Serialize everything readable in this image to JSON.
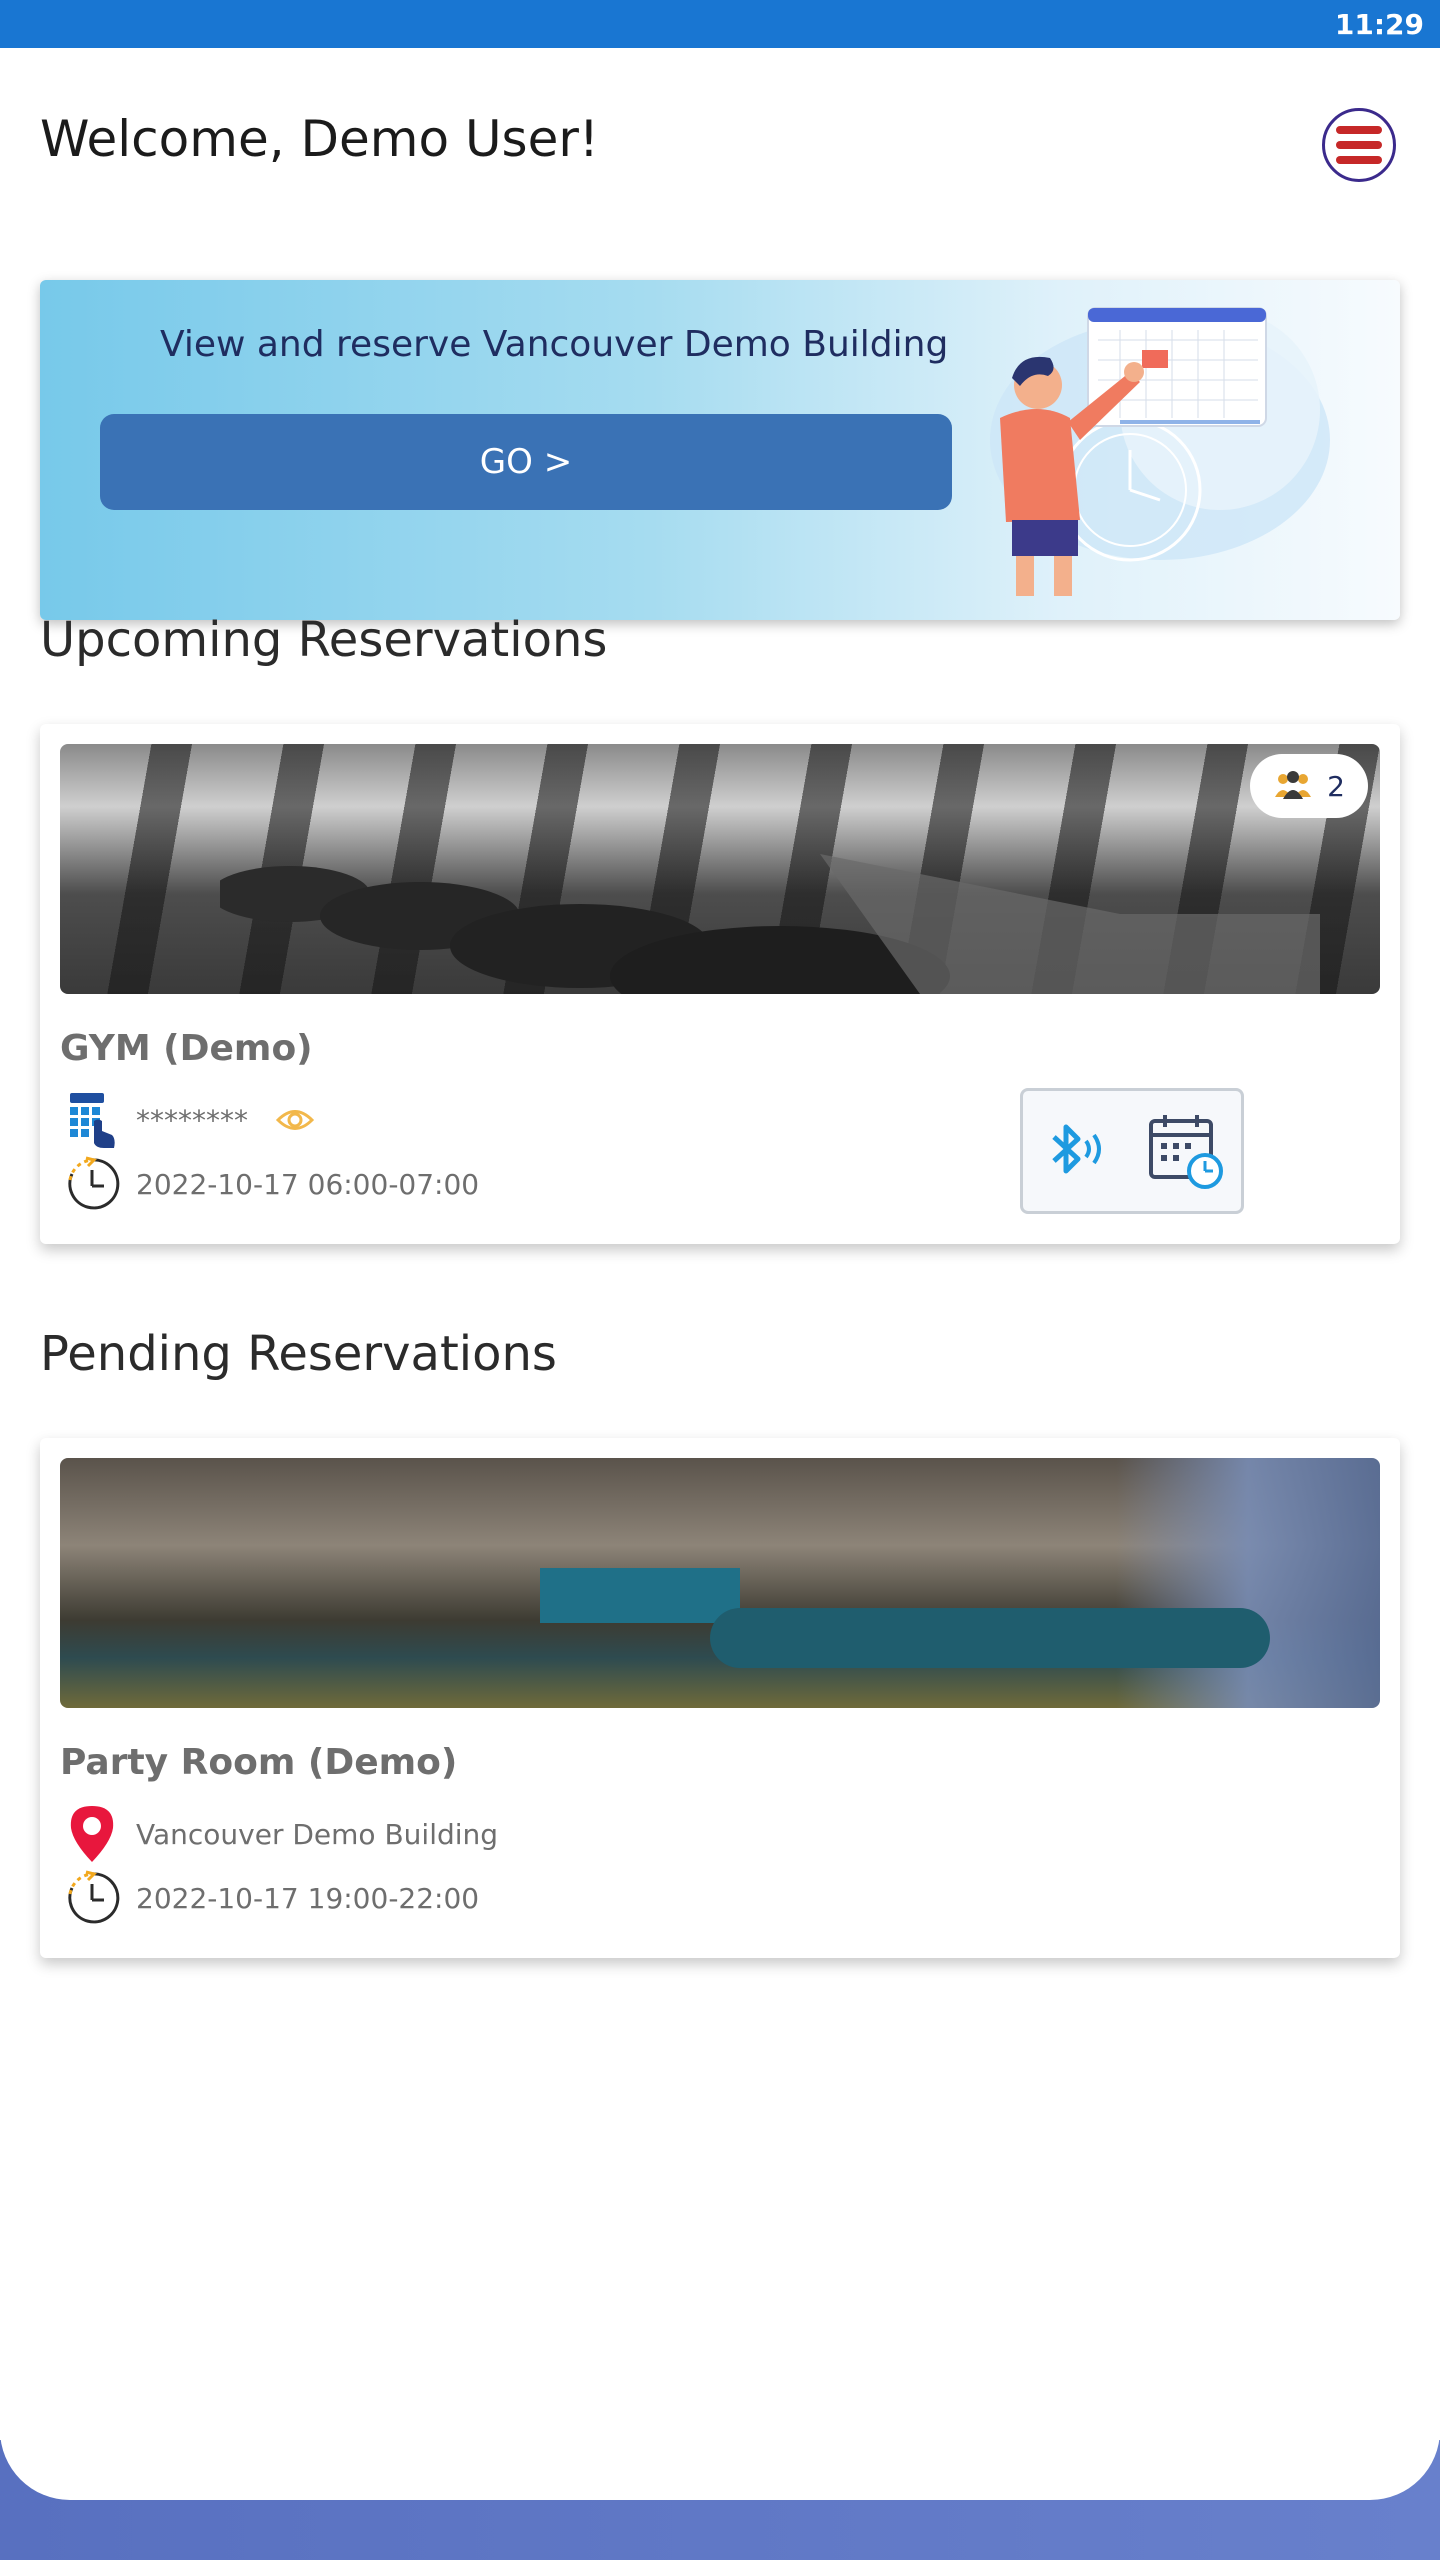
{
  "status_bar": {
    "time": "11:29"
  },
  "header": {
    "welcome": "Welcome, Demo User!",
    "menu_icon": "hamburger-menu-icon"
  },
  "banner": {
    "title": "View and reserve Vancouver Demo Building",
    "go_label": "GO >"
  },
  "upcoming": {
    "section_title": "Upcoming Reservations",
    "card": {
      "name": "GYM (Demo)",
      "participant_count": "2",
      "code": "********",
      "time": "2022-10-17 06:00-07:00"
    }
  },
  "pending": {
    "section_title": "Pending Reservations",
    "card": {
      "name": "Party Room (Demo)",
      "location": "Vancouver Demo Building",
      "time": "2022-10-17 19:00-22:00"
    }
  },
  "colors": {
    "status_bar": "#1976d2",
    "go_button": "#3a72b5",
    "menu_red": "#c62828",
    "bluetooth": "#1e9ae0",
    "pin_red": "#e8173d",
    "eye_yellow": "#f2b84b"
  }
}
